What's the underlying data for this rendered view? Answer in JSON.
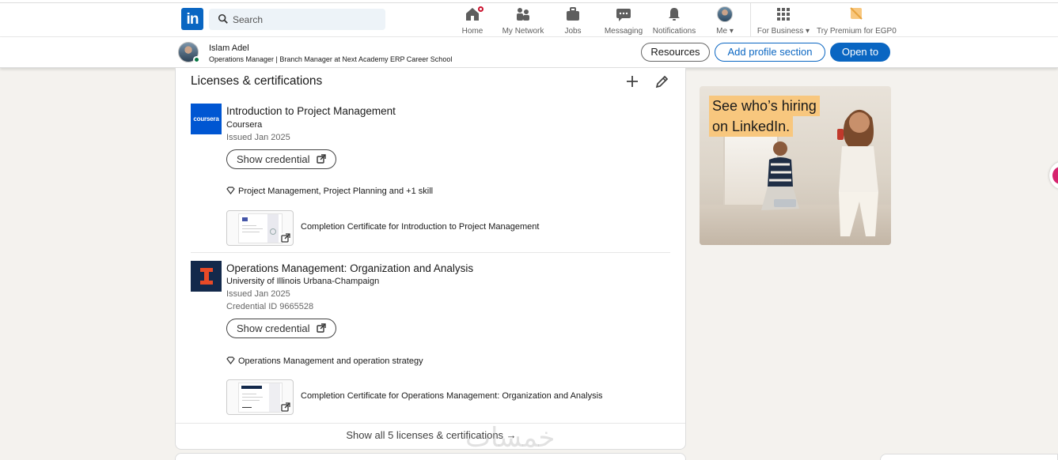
{
  "nav": {
    "logo_text": "in",
    "search_placeholder": "Search",
    "items": [
      {
        "label": "Home",
        "icon": "home-icon"
      },
      {
        "label": "My Network",
        "icon": "people-icon"
      },
      {
        "label": "Jobs",
        "icon": "briefcase-icon"
      },
      {
        "label": "Messaging",
        "icon": "chat-icon"
      },
      {
        "label": "Notifications",
        "icon": "bell-icon"
      },
      {
        "label": "Me",
        "icon": "avatar"
      },
      {
        "label": "For Business",
        "icon": "grid-icon"
      },
      {
        "label": "Try Premium for EGP0",
        "icon": "premium-icon"
      }
    ]
  },
  "profile_bar": {
    "name": "Islam Adel",
    "headline": "Operations Manager | Branch Manager at Next Academy ERP Career School",
    "buttons": {
      "resources": "Resources",
      "add_section": "Add profile section",
      "open_to": "Open to"
    }
  },
  "licenses": {
    "title": "Licenses & certifications",
    "entries": [
      {
        "logo_text": "coursera",
        "title": "Introduction to Project Management",
        "issuer": "Coursera",
        "issued": "Issued Jan 2025",
        "credential_button": "Show credential",
        "skills": "Project Management, Project Planning and +1 skill",
        "document_title": "Completion Certificate for Introduction to Project Management"
      },
      {
        "logo_text": "I",
        "title": "Operations Management: Organization and Analysis",
        "issuer": "University of Illinois Urbana-Champaign",
        "issued": "Issued Jan 2025",
        "credential_id": "Credential ID 9665528",
        "credential_button": "Show credential",
        "skills": "Operations Management and operation strategy",
        "document_title": "Completion Certificate for Operations Management: Organization and Analysis"
      }
    ],
    "show_all": "Show all 5 licenses & certifications →"
  },
  "ad": {
    "headline_line1": "See who’s hiring",
    "headline_line2": "on LinkedIn."
  },
  "watermark": "خمسات",
  "colors": {
    "brand_blue": "#0a66c2",
    "badge_red": "#cb112d",
    "online_green": "#057642",
    "coursera_blue": "#0056d2",
    "illinois_navy": "#13294b",
    "illinois_orange": "#e84a27",
    "ad_highlight": "#f8c77e"
  }
}
